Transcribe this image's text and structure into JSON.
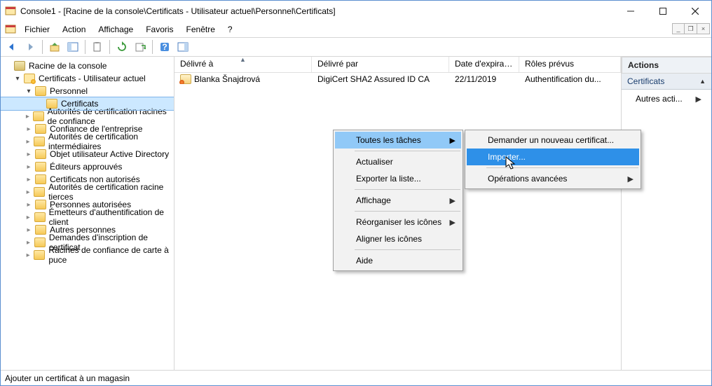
{
  "title": "Console1 - [Racine de la console\\Certificats - Utilisateur actuel\\Personnel\\Certificats]",
  "menu": {
    "fichier": "Fichier",
    "action": "Action",
    "affichage": "Affichage",
    "favoris": "Favoris",
    "fenetre": "Fenêtre",
    "aide": "?"
  },
  "tree": {
    "root": "Racine de la console",
    "certs_user": "Certificats - Utilisateur actuel",
    "personnel": "Personnel",
    "certificats": "Certificats",
    "items": [
      "Autorités de certification racines de confiance",
      "Confiance de l'entreprise",
      "Autorités de certification intermédiaires",
      "Objet utilisateur Active Directory",
      "Éditeurs approuvés",
      "Certificats non autorisés",
      "Autorités de certification racine tierces",
      "Personnes autorisées",
      "Émetteurs d'authentification de client",
      "Autres personnes",
      "Demandes d'inscription de certificat",
      "Racines de confiance de carte à puce"
    ]
  },
  "columns": {
    "c0": "Délivré à",
    "c1": "Délivré par",
    "c2": "Date d'expirati...",
    "c3": "Rôles prévus"
  },
  "row0": {
    "c0": "Blanka Šnajdrová",
    "c1": "DigiCert SHA2 Assured ID CA",
    "c2": "22/11/2019",
    "c3": "Authentification du..."
  },
  "actions": {
    "head": "Actions",
    "section": "Certificats",
    "item": "Autres acti..."
  },
  "status": "Ajouter un certificat à un magasin",
  "ctx1": {
    "toutes": "Toutes les tâches",
    "actualiser": "Actualiser",
    "exporter": "Exporter la liste...",
    "affichage": "Affichage",
    "reorg": "Réorganiser les icônes",
    "aligner": "Aligner les icônes",
    "aide": "Aide"
  },
  "ctx2": {
    "demander": "Demander un nouveau certificat...",
    "importer": "Importer...",
    "ops": "Opérations avancées"
  }
}
